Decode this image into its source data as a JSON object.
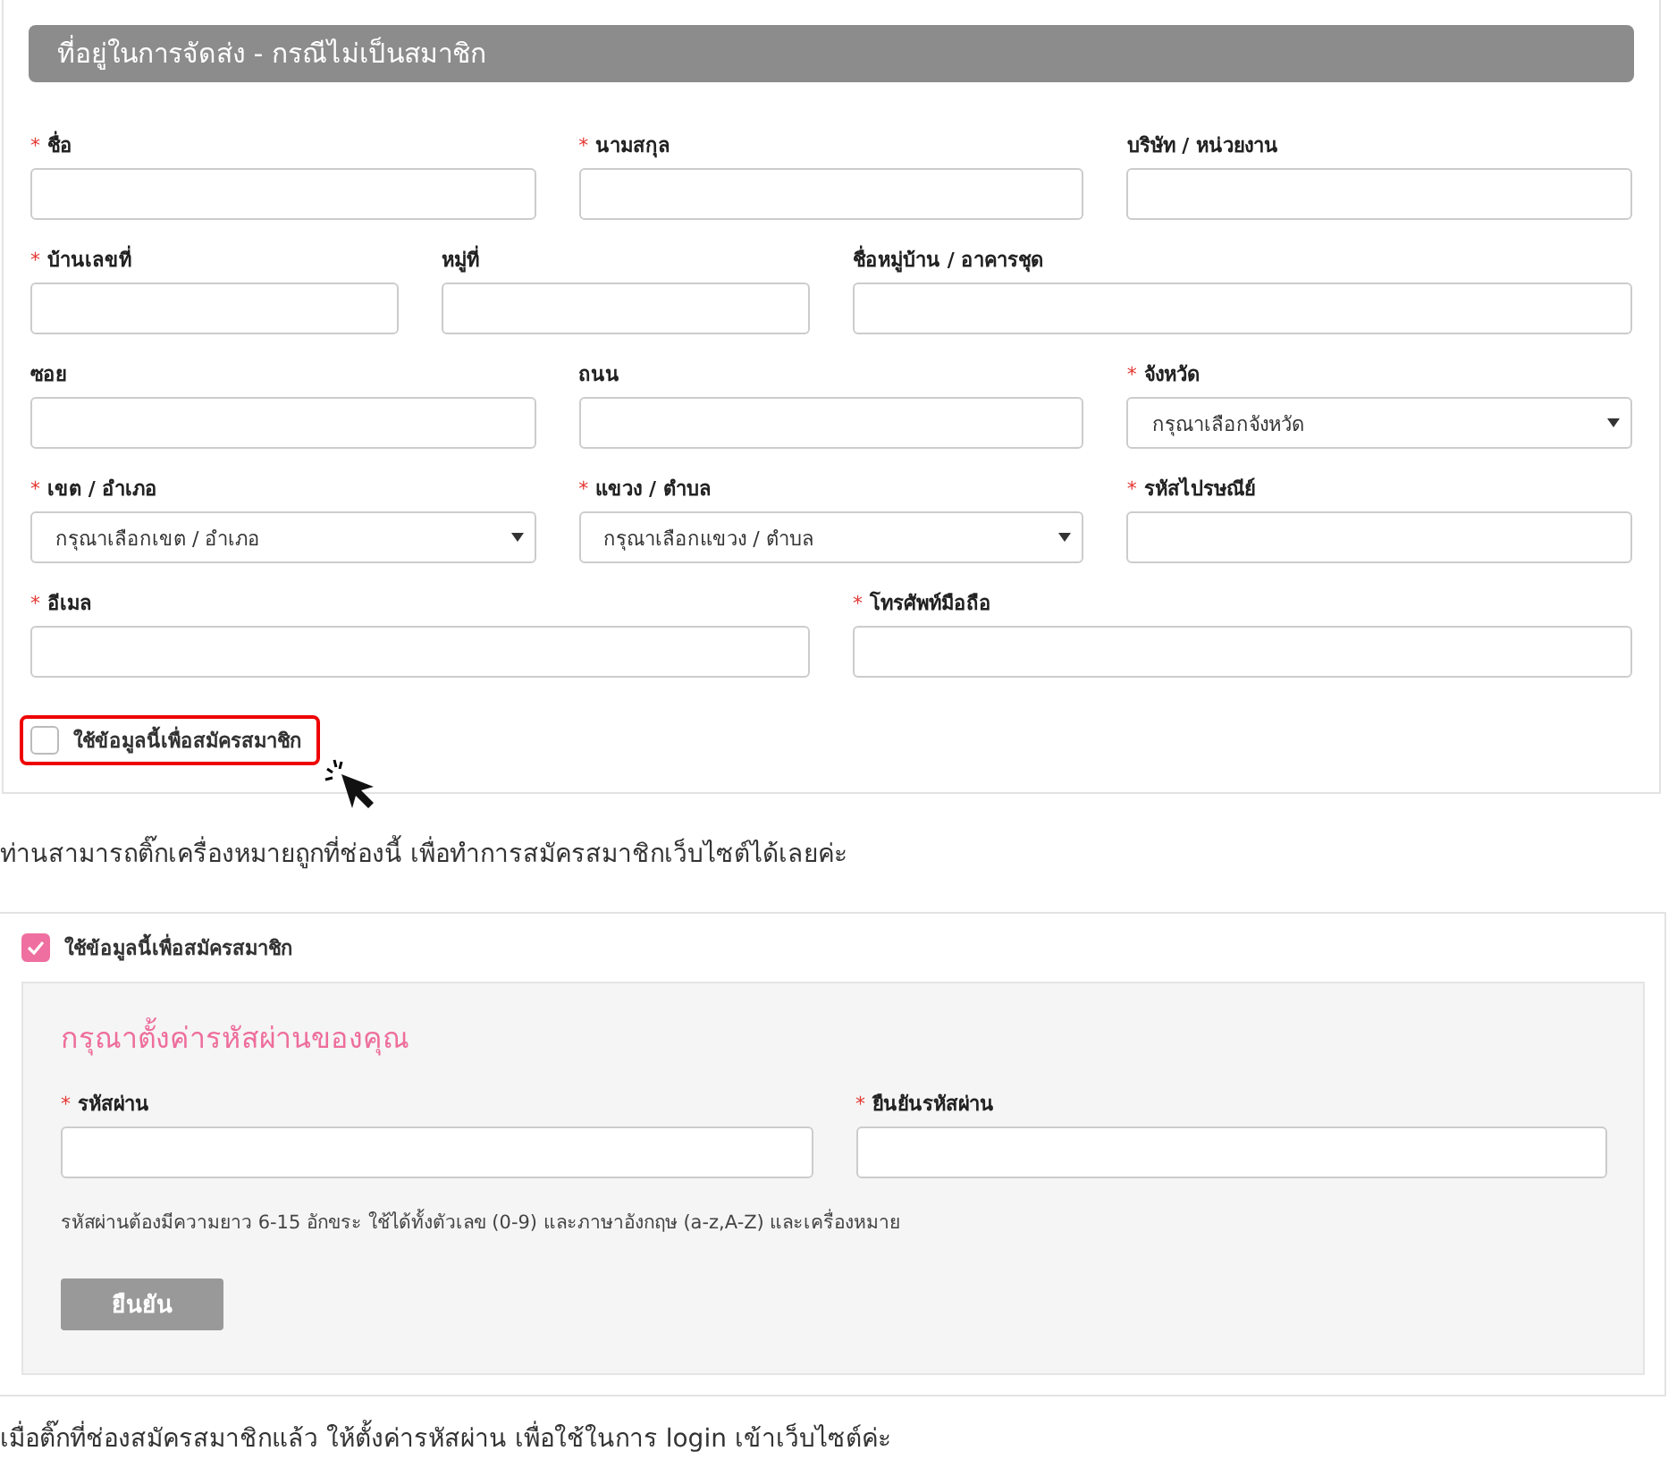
{
  "address_form": {
    "title": "ที่อยู่ในการจัดส่ง - กรณีไม่เป็นสมาชิก",
    "rows": [
      [
        {
          "marker": "*",
          "label": "ชื่อ",
          "kind": "input"
        },
        {
          "marker": "*",
          "label": "นามสกุล",
          "kind": "input"
        },
        {
          "label": "บริษัท / หน่วยงาน",
          "kind": "input"
        }
      ],
      [
        {
          "marker": "*",
          "label": "บ้านเลขที่",
          "kind": "input"
        },
        {
          "label": "หมู่ที่",
          "kind": "input"
        },
        {
          "label": "ชื่อหมู่บ้าน / อาคารชุด",
          "kind": "input"
        }
      ],
      [
        {
          "label": "ซอย",
          "kind": "input"
        },
        {
          "label": "ถนน",
          "kind": "input"
        },
        {
          "marker": "*",
          "label": "จังหวัด",
          "kind": "select",
          "value": "กรุณาเลือกจังหวัด"
        }
      ],
      [
        {
          "marker": "*",
          "label": "เขต / อำเภอ",
          "kind": "select",
          "value": "กรุณาเลือกเขต / อำเภอ"
        },
        {
          "marker": "*",
          "label": "แขวง / ตำบล",
          "kind": "select",
          "value": "กรุณาเลือกแขวง / ตำบล"
        },
        {
          "marker": "*",
          "label": "รหัสไปรษณีย์",
          "kind": "input"
        }
      ],
      [
        {
          "marker": "*",
          "label": "อีเมล",
          "kind": "input"
        },
        {
          "marker": "*",
          "label": "โทรศัพท์มือถือ",
          "kind": "input"
        }
      ]
    ],
    "register_checkbox": {
      "label": "ใช้ข้อมูลนี้เพื่อสมัครสมาชิก",
      "checked": false,
      "highlighted": true
    }
  },
  "caption_1": "ท่านสามารถติ๊กเครื่องหมายถูกที่ช่องนี้ เพื่อทำการสมัครสมาชิกเว็บไซต์ได้เลยค่ะ",
  "register_form": {
    "checkbox": {
      "label": "ใช้ข้อมูลนี้เพื่อสมัครสมาชิก",
      "checked": true
    },
    "title": "กรุณาตั้งค่ารหัสผ่านของคุณ",
    "fields": [
      {
        "marker": "*",
        "label": "รหัสผ่าน"
      },
      {
        "marker": "*",
        "label": "ยืนยันรหัสผ่าน"
      }
    ],
    "hint": "รหัสผ่านต้องมีความยาว 6-15 อักขระ ใช้ได้ทั้งตัวเลข (0-9) และภาษาอังกฤษ (a-z,A-Z) และเครื่องหมาย",
    "button": "ยืนยัน"
  },
  "caption_2": "เมื่อติ๊กที่ช่องสมัครสมาชิกแล้ว ให้ตั้งค่ารหัสผ่าน เพื่อใช้ในการ login เข้าเว็บไซต์ค่ะ"
}
